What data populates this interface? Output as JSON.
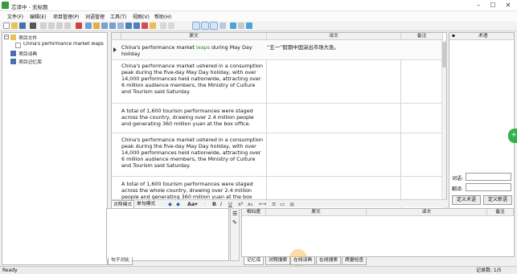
{
  "window": {
    "title": "芯译中 - 无标题"
  },
  "menu": [
    "文件(F)",
    "编辑(E)",
    "项目管理(P)",
    "词语管理",
    "工具(T)",
    "视图(V)",
    "帮助(H)"
  ],
  "project_tree": {
    "items": [
      {
        "label": "项目文件"
      },
      {
        "label": "China's performance market leaps"
      },
      {
        "label": "项目词典"
      },
      {
        "label": "项目记忆库"
      }
    ]
  },
  "grid": {
    "headers": {
      "source": "原文",
      "target": "译文",
      "note": "备注"
    },
    "rows": [
      {
        "source_before": "China's performance market ",
        "source_highlight": "leaps",
        "source_after": " during May Day holiday",
        "target": "“五一”假期中国演出市场大涨。"
      },
      {
        "source": "China's performance market ushered in a consumption peak during the five-day May Day holiday, with over 14,000 performances held nationwide, attracting over 6 million audience members, the Ministry of Culture and Tourism said Saturday.",
        "target": ""
      },
      {
        "source": "A total of 1,600 tourism performances were staged across the country, drawing over 2.4 million people and generating 360 million yuan at the box office.",
        "target": ""
      },
      {
        "source": "China's performance market ushered in a consumption peak during the five-day May Day holiday, with over 14,000 performances held nationwide, attracting over 6 million audience members, the Ministry of Culture and Tourism said Saturday.",
        "target": ""
      },
      {
        "source": "A total of 1,600 tourism performances were staged across the whole country, drawing over 2.4 million people and generating 360 million yuan at the box",
        "target": ""
      }
    ]
  },
  "terms": {
    "header": "术语",
    "source_label": "词语:",
    "target_label": "翻译:",
    "define_button": "定义术语",
    "add_button": "定义新语"
  },
  "bottom_tabs": {
    "compare_mode": "对照模式",
    "single_mode": "单句模式"
  },
  "match_headers": {
    "similarity": "相似度",
    "source": "原文",
    "target": "译文",
    "note": "备注"
  },
  "lower_left_tab": "句子对比",
  "lower_tabs": [
    "记忆库",
    "对照搜索",
    "在线词典",
    "在线搜索",
    "质量检查"
  ],
  "status": {
    "left": "Ready",
    "right": "记录数: 1/5"
  }
}
